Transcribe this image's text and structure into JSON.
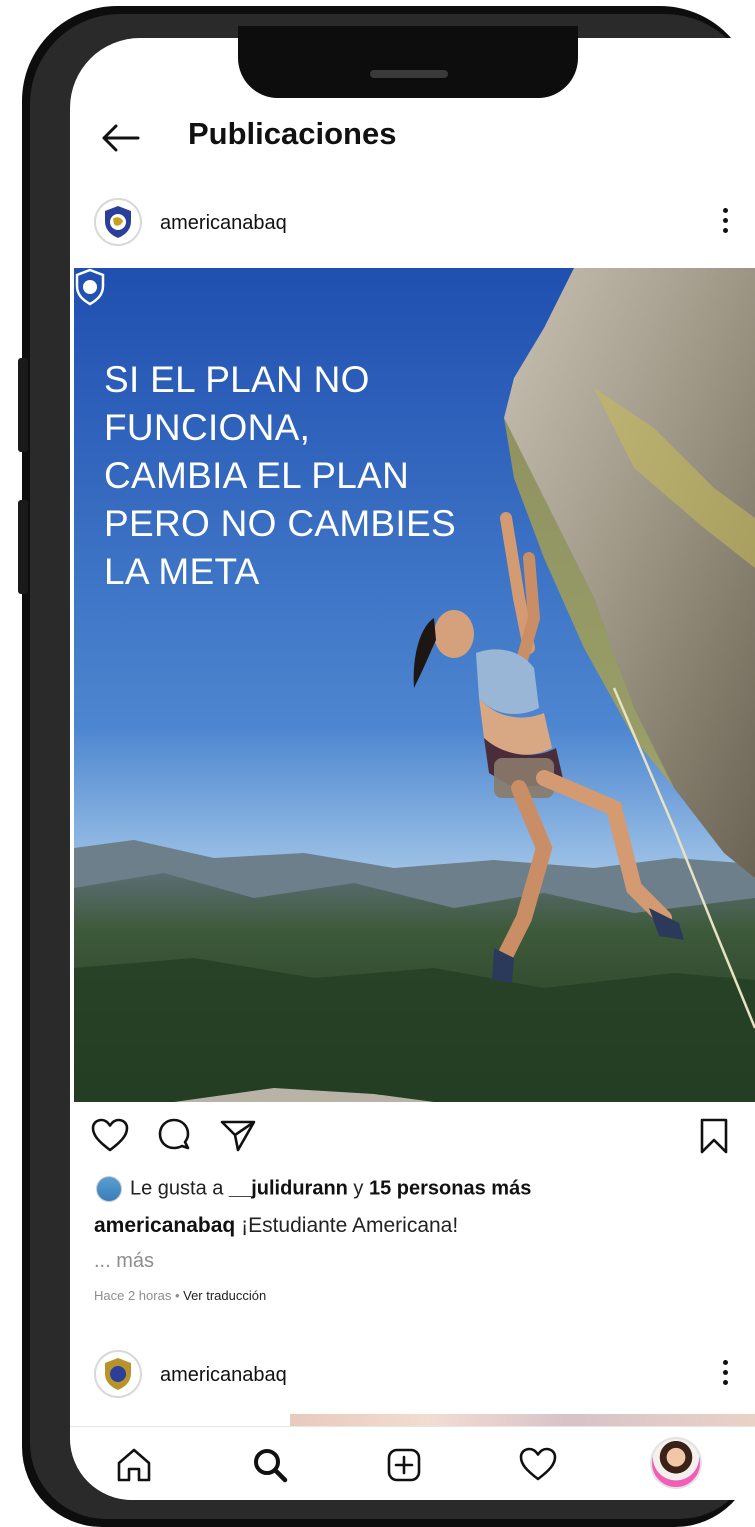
{
  "header": {
    "title": "Publicaciones"
  },
  "post": {
    "username": "americanabaq",
    "quote_lines": [
      "SI EL PLAN NO",
      "FUNCIONA,",
      "CAMBIA EL PLAN",
      "PERO NO CAMBIES",
      "LA META"
    ],
    "likes_prefix": "Le gusta a ",
    "likes_user": "__julidurann",
    "likes_mid": " y ",
    "likes_count": "15 personas más",
    "caption_user": "americanabaq",
    "caption_text": " ¡Estudiante Americana!",
    "more_link": "... más",
    "time": "Hace 2 horas",
    "time_sep": " • ",
    "translate": "Ver traducción"
  },
  "post2": {
    "username": "americanabaq"
  },
  "icons": {
    "back": "arrow-left-icon",
    "more": "more-vertical-icon",
    "like": "heart-icon",
    "comment": "comment-icon",
    "share": "send-icon",
    "save": "bookmark-icon",
    "nav": [
      "home-icon",
      "search-icon",
      "add-post-icon",
      "activity-heart-icon",
      "profile-avatar"
    ]
  },
  "colors": {
    "sky_top": "#1f4fb0",
    "sky_bottom": "#8fb8e2",
    "forest": "#2f4a2c",
    "text": "#111111",
    "muted": "#8e8e8e"
  }
}
